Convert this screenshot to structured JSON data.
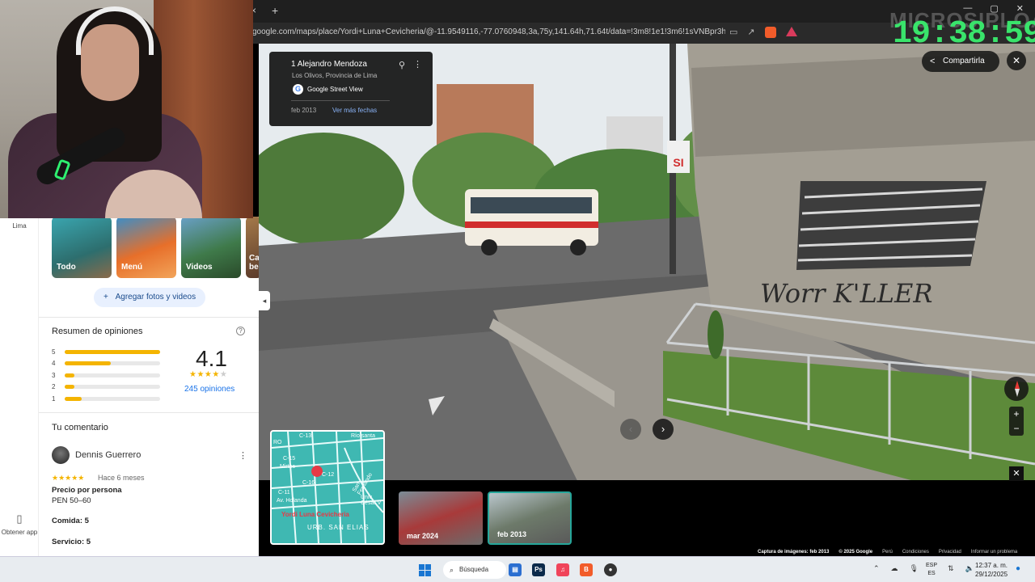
{
  "browser": {
    "url": "google.com/maps/place/Yordi+Luna+Cevicheria/@-11.9549116,-77.0760948,3a,75y,141.64h,71.64t/data=!3m8!1e1!3m6!1sVNBpr3hJUEAtePd5...",
    "tab_close": "×",
    "new_tab": "+",
    "window_controls": [
      "—",
      "▢",
      "✕"
    ]
  },
  "overlay": {
    "watermark": "MICROSIPLOA",
    "clock": "19:38:59"
  },
  "rail": {
    "top_label": "Lima",
    "bottom_label": "Obtener app"
  },
  "photos": {
    "tiles": [
      {
        "label": "Todo",
        "color": "#2e8b8b"
      },
      {
        "label": "Menú",
        "color": "#e76f2a"
      },
      {
        "label": "Videos",
        "color": "#3f7a4a"
      },
      {
        "label": "Ca be",
        "color": "#7a5a3a"
      }
    ],
    "add_button": "Agregar fotos y videos",
    "add_icon": "+"
  },
  "ratings": {
    "section_title": "Resumen de opiniones",
    "help_icon": "?",
    "rows": [
      {
        "star": "5",
        "fraction": 1.0
      },
      {
        "star": "4",
        "fraction": 0.48
      },
      {
        "star": "3",
        "fraction": 0.1
      },
      {
        "star": "2",
        "fraction": 0.1
      },
      {
        "star": "1",
        "fraction": 0.18
      }
    ],
    "average": "4.1",
    "stars_on": "★★★★",
    "stars_off": "★",
    "count_link": "245 opiniones"
  },
  "review": {
    "section_title": "Tu comentario",
    "author": "Dennis Guerrero",
    "menu_icon": "⋮",
    "stars": "★★★★★",
    "when": "Hace 6 meses",
    "price_label": "Precio por persona",
    "price_value": "PEN 50–60",
    "food": "Comida: 5",
    "service": "Servicio: 5"
  },
  "info_card": {
    "title": "1 Alejandro Mendoza",
    "subtitle": "Los Olivos, Provincia de Lima",
    "source": "Google Street View",
    "google_letter": "G",
    "date": "feb 2013",
    "more_dates": "Ver más fechas",
    "pin_icon": "⚲",
    "kebab": "⋮"
  },
  "street_view": {
    "share_label": "Compartirla",
    "share_icon": "<",
    "close_icon": "✕",
    "collapse_icon": "◂",
    "prev_icon": "‹",
    "next_icon": "›",
    "zoom_in": "+",
    "zoom_out": "−",
    "mini_close": "✕"
  },
  "minimap": {
    "place": "Yordi Luna Cevicheria",
    "district": "URB. SAN ELIAS",
    "labels": [
      "RO",
      "C-13",
      "C-15",
      "Río santa",
      "Mirtos",
      "C-12",
      "C-16",
      "C-11",
      "Av. Holanda",
      "San Fernando",
      "Univ César V"
    ]
  },
  "thumbnails": [
    {
      "label": "mar 2024",
      "selected": false
    },
    {
      "label": "feb 2013",
      "selected": true
    }
  ],
  "footer": {
    "capture": "Captura de imágenes: feb 2013",
    "copyright": "© 2025 Google",
    "links": [
      "Perú",
      "Condiciones",
      "Privacidad",
      "Informar un problema"
    ]
  },
  "taskbar": {
    "search": "Búsqueda",
    "apps": [
      {
        "name": "file-explorer",
        "glyph": "▤",
        "color": "#2b6fd1"
      },
      {
        "name": "photoshop",
        "glyph": "Ps",
        "color": "#0b2a4a"
      },
      {
        "name": "itunes",
        "glyph": "♫",
        "color": "#f0445a"
      },
      {
        "name": "brave",
        "glyph": "B",
        "color": "#f25c2a"
      },
      {
        "name": "obs",
        "glyph": "●",
        "color": "#333"
      }
    ],
    "lang_top": "ESP",
    "lang_bottom": "ES",
    "time": "12:37 a. m.",
    "date": "29/12/2025"
  }
}
